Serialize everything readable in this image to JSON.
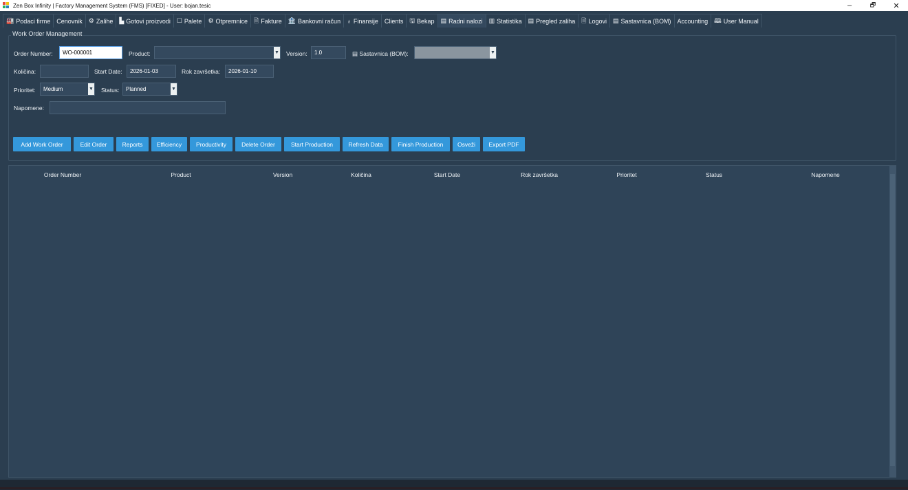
{
  "window": {
    "title": "Zen Box Infinity | Factory Management System (FMS) [FIXED] - User: bojan.tesic",
    "controls": [
      "–",
      "🗗",
      "✕"
    ]
  },
  "tabs": [
    {
      "icon": "🏭",
      "label": "Podaci firme"
    },
    {
      "icon": "",
      "label": "Cenovnik"
    },
    {
      "icon": "⚙",
      "label": "Zalihe"
    },
    {
      "icon": "▙",
      "label": "Gotovi proizvodi"
    },
    {
      "icon": "☐",
      "label": "Palete"
    },
    {
      "icon": "⚙",
      "label": "Otpremnice"
    },
    {
      "icon": "🗎",
      "label": "Fakture"
    },
    {
      "icon": "🏦",
      "label": "Bankovni račun"
    },
    {
      "icon": "♁",
      "label": "Finansije"
    },
    {
      "icon": "",
      "label": "Clients"
    },
    {
      "icon": "🖫",
      "label": "Bekap"
    },
    {
      "icon": "▤",
      "label": "Radni nalozi"
    },
    {
      "icon": "▥",
      "label": "Statistika"
    },
    {
      "icon": "▤",
      "label": "Pregled zaliha"
    },
    {
      "icon": "🗎",
      "label": "Logovi"
    },
    {
      "icon": "▤",
      "label": "Sastavnica (BOM)"
    },
    {
      "icon": "",
      "label": "Accounting"
    },
    {
      "icon": "🕮",
      "label": "User Manual"
    }
  ],
  "form": {
    "group_title": "Work Order Management",
    "order_number_label": "Order Number:",
    "order_number_value": "WO-000001",
    "product_label": "Product:",
    "product_value": "",
    "version_label": "Version:",
    "version_value": "1.0",
    "bom_icon": "▤",
    "bom_label": "Sastavnica (BOM):",
    "bom_value": "",
    "kolicina_label": "Količina:",
    "kolicina_value": "",
    "start_date_label": "Start Date:",
    "start_date_value": "2026-01-03",
    "rok_label": "Rok završetka:",
    "rok_value": "2026-01-10",
    "prioritet_label": "Prioritet:",
    "prioritet_value": "Medium",
    "status_label": "Status:",
    "status_value": "Planned",
    "napomene_label": "Napomene:",
    "napomene_value": ""
  },
  "buttons": [
    "Add Work Order",
    "Edit Order",
    "Reports",
    "Efficiency",
    "Productivity",
    "Delete Order",
    "Start Production",
    "Refresh Data",
    "Finish Production",
    "Osveži",
    "Export PDF"
  ],
  "table": {
    "columns": [
      "Order Number",
      "Product",
      "Version",
      "Količina",
      "Start Date",
      "Rok završetka",
      "Prioritet",
      "Status",
      "Napomene"
    ],
    "rows": []
  },
  "colors": {
    "background": "#2b3e50",
    "button": "#3498db",
    "field": "#34495e"
  }
}
